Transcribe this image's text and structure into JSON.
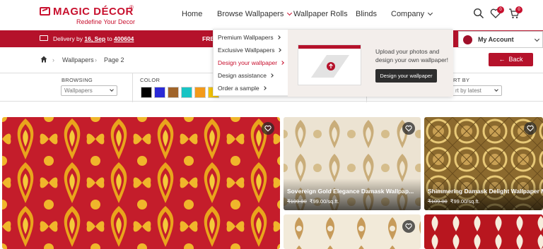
{
  "brand": {
    "name": "MAGIC DÉCOR",
    "reg": "®",
    "tagline": "Redefine Your Decor",
    "color": "#c8102e"
  },
  "nav": {
    "home": "Home",
    "browse": "Browse Wallpapers",
    "rolls": "Wallpaper Rolls",
    "blinds": "Blinds",
    "company": "Company"
  },
  "header_icons": {
    "wishlist_count": "0",
    "cart_count": "0",
    "search": "search-icon",
    "wishlist": "heart-icon",
    "cart": "cart-icon"
  },
  "delivery": {
    "prefix": "Delivery by",
    "date": "16, Sep",
    "to": "to",
    "pincode": "400604"
  },
  "promo_fragment": "FRE",
  "account": {
    "label": "My Account"
  },
  "breadcrumb": {
    "items": [
      "Wallpapers",
      "Page 2"
    ]
  },
  "back_label": "Back",
  "filters": {
    "browsing_label": "BROWSING",
    "browsing_value": "Wallpapers",
    "color_label": "COLOR",
    "swatches": [
      "#000000",
      "#2a2ad6",
      "#a0642a",
      "#18c4c4",
      "#f39a1a",
      "#f5c400"
    ],
    "sort_label": "RT BY",
    "sort_value": "rt by latest"
  },
  "dropdown": {
    "items": [
      "Premium Wallpapers",
      "Exclusive Wallpapers",
      "Design your wallpaper",
      "Design assistance",
      "Order a sample"
    ],
    "active_index": 2,
    "copy_line1": "Upload your photos and",
    "copy_line2": "design your own wallpaper!",
    "button": "Design your wallpaper"
  },
  "products": [
    {
      "title": "Sovereign Gold Elegance Damask Wallpap...",
      "old_price": "₹109.00",
      "price": "₹99.00/sq.ft."
    },
    {
      "title": "Shimmering Damask Delight Wallpaper Mur",
      "old_price": "₹109.00",
      "price": "₹99.00/sq.ft."
    }
  ]
}
